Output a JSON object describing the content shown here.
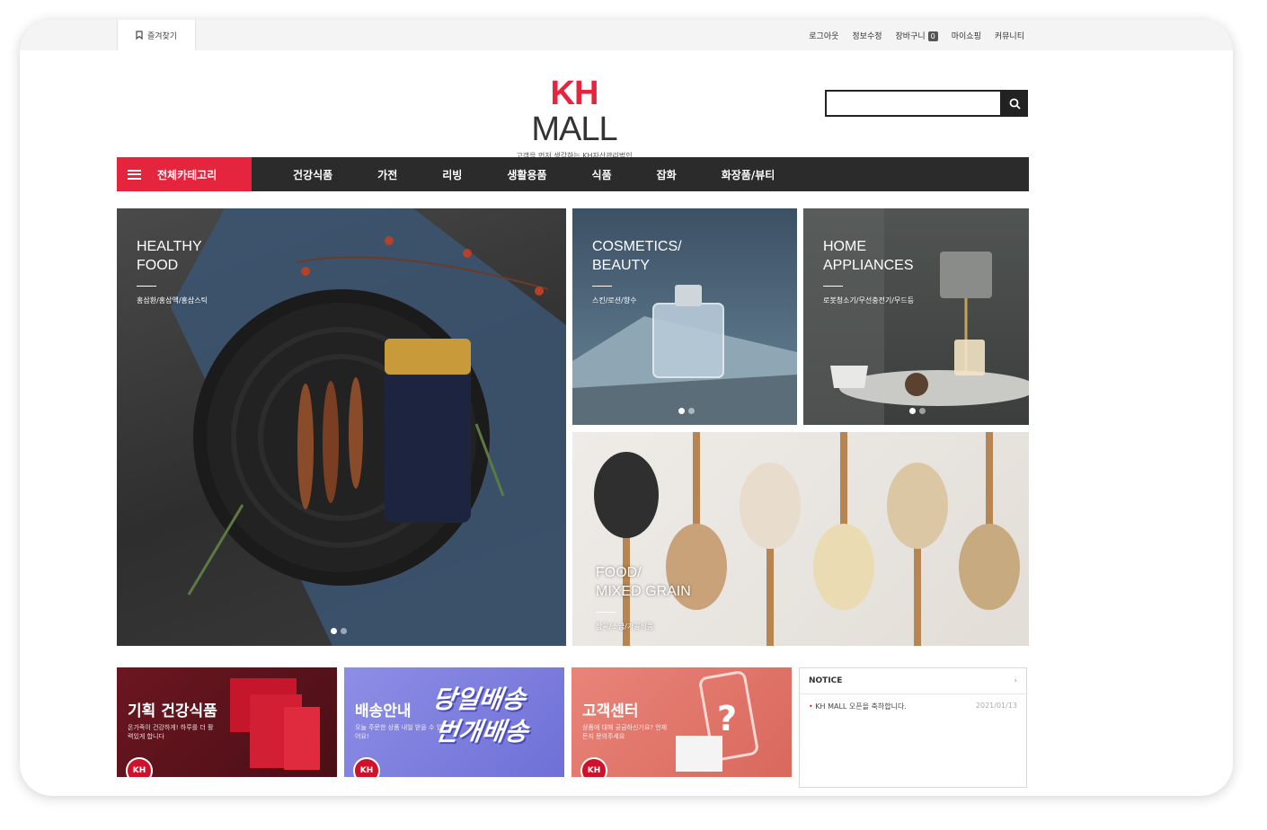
{
  "topbar": {
    "bookmark_label": "즐겨찾기",
    "links": [
      "로그아웃",
      "정보수정",
      "장바구니",
      "마이쇼핑",
      "커뮤니티"
    ],
    "cart_count": "0"
  },
  "header": {
    "logo_kh": "KH",
    "logo_mall": " MALL",
    "tagline": "고객을 먼저 생각하는 KH자산관리법인",
    "search_placeholder": ""
  },
  "nav": {
    "all_categories": "전체카테고리",
    "items": [
      "건강식품",
      "가전",
      "리빙",
      "생활용품",
      "식품",
      "잡화",
      "화장품/뷰티"
    ]
  },
  "banners": {
    "healthy": {
      "title_1": "HEALTHY",
      "title_2": "FOOD",
      "sub": "홍삼환/홍삼액/홍삼스틱"
    },
    "cosmetics": {
      "title_1": "COSMETICS/",
      "title_2": "BEAUTY",
      "sub": "스킨/로션/향수"
    },
    "home": {
      "title_1": "HOME",
      "title_2": "APPLIANCES",
      "sub": "로봇청소기/무선충전기/무드등"
    },
    "grain": {
      "title_1": "FOOD/",
      "title_2": "MIXED GRAIN",
      "sub": "잡곡/소금/가공식품"
    }
  },
  "promos": [
    {
      "title": "기획 건강식품",
      "sub": "온가족이 건강하게! 하루를 더 활력있게 합니다"
    },
    {
      "title": "배송안내",
      "sub": "오늘 주문한 상품 내일 받을 수 있어요!",
      "big_1": "당일배송",
      "big_2": "번개배송"
    },
    {
      "title": "고객센터",
      "sub": "상품에 대해 궁금하신가요? 언제든지 문의주세요"
    }
  ],
  "kh_badge": "KH",
  "notice": {
    "header": "NOTICE",
    "arrow": "›",
    "items": [
      {
        "text": "KH MALL 오픈을 축하합니다.",
        "date": "2021/01/13"
      }
    ]
  },
  "colors": {
    "brand_red": "#e4253d",
    "nav_dark": "#2b2b2b"
  }
}
